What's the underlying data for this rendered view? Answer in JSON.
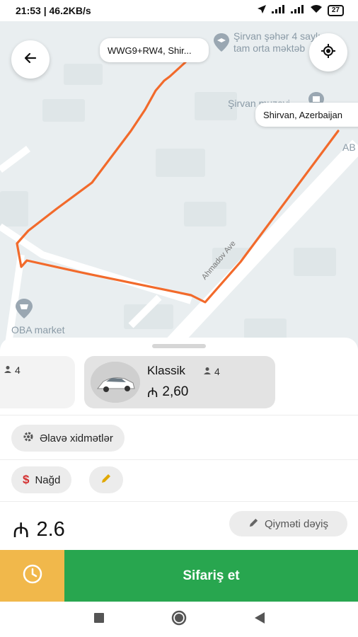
{
  "status_bar": {
    "left_text": "21:53 | 46.2KB/s",
    "battery": "27"
  },
  "map": {
    "labels": {
      "school": "Şirvan şəhər 4 saylı\ntam orta məktəb",
      "school_line1": "Şirvan şəhər 4 saylı",
      "school_line2": "tam orta məktəb",
      "museum": "Şirvan muzeyi",
      "market": "OBA market",
      "street": "Ahmadov Ave",
      "ab": "AB"
    },
    "origin_label": "WWG9+RW4, Shir...",
    "destination_label": "Shirvan, Azerbaijan",
    "colors": {
      "route": "#f26a2b",
      "map_bg": "#e9eef0",
      "road": "#ffffff"
    }
  },
  "tariffs": [
    {
      "name": "",
      "seats": "4",
      "price": ""
    },
    {
      "name": "Klassik",
      "seats": "4",
      "price": "2,60",
      "currency": "₼"
    }
  ],
  "extra_services_label": "Əlavə xidmətlər",
  "payment": {
    "label": "Nağd",
    "icon": "$"
  },
  "total": {
    "currency": "₼",
    "amount": "2.6"
  },
  "change_price_label": "Qiyməti dəyiş",
  "order_button_label": "Sifariş et",
  "colors": {
    "order": "#28a64f",
    "schedule": "#f1b84b",
    "cash_icon": "#d32f2f",
    "edit_icon": "#e0a800"
  }
}
